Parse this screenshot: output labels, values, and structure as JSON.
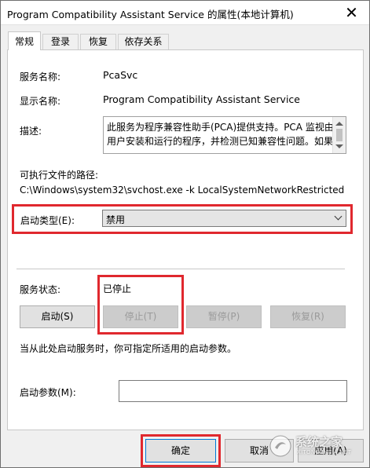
{
  "window": {
    "title": "Program Compatibility Assistant Service 的属性(本地计算机)"
  },
  "tabs": [
    {
      "label": "常规",
      "active": true
    },
    {
      "label": "登录",
      "active": false
    },
    {
      "label": "恢复",
      "active": false
    },
    {
      "label": "依存关系",
      "active": false
    }
  ],
  "general": {
    "service_name_label": "服务名称:",
    "service_name_value": "PcaSvc",
    "display_name_label": "显示名称:",
    "display_name_value": "Program Compatibility Assistant Service",
    "description_label": "描述:",
    "description_text": "此服务为程序兼容性助手(PCA)提供支持。PCA 监视由用户安装和运行的程序，并检测已知兼容性问题。如果",
    "exe_path_label": "可执行文件的路径:",
    "exe_path_value": "C:\\Windows\\system32\\svchost.exe -k LocalSystemNetworkRestricted",
    "startup_type_label": "启动类型(E):",
    "startup_type_value": "禁用",
    "service_status_label": "服务状态:",
    "service_status_value": "已停止",
    "start_button": "启动(S)",
    "stop_button": "停止(T)",
    "pause_button": "暂停(P)",
    "resume_button": "恢复(R)",
    "hint_text": "当从此处启动服务时，你可指定所适用的启动参数。",
    "start_params_label": "启动参数(M):",
    "start_params_value": ""
  },
  "footer": {
    "ok_button": "确定",
    "cancel_button": "取消",
    "apply_button": "应用(A)"
  },
  "watermark": {
    "text": "系统之家",
    "sub": "XITONGZHIJIA.NET"
  },
  "colors": {
    "highlight_frame": "#e0282e",
    "accent_border": "#0078d7"
  }
}
